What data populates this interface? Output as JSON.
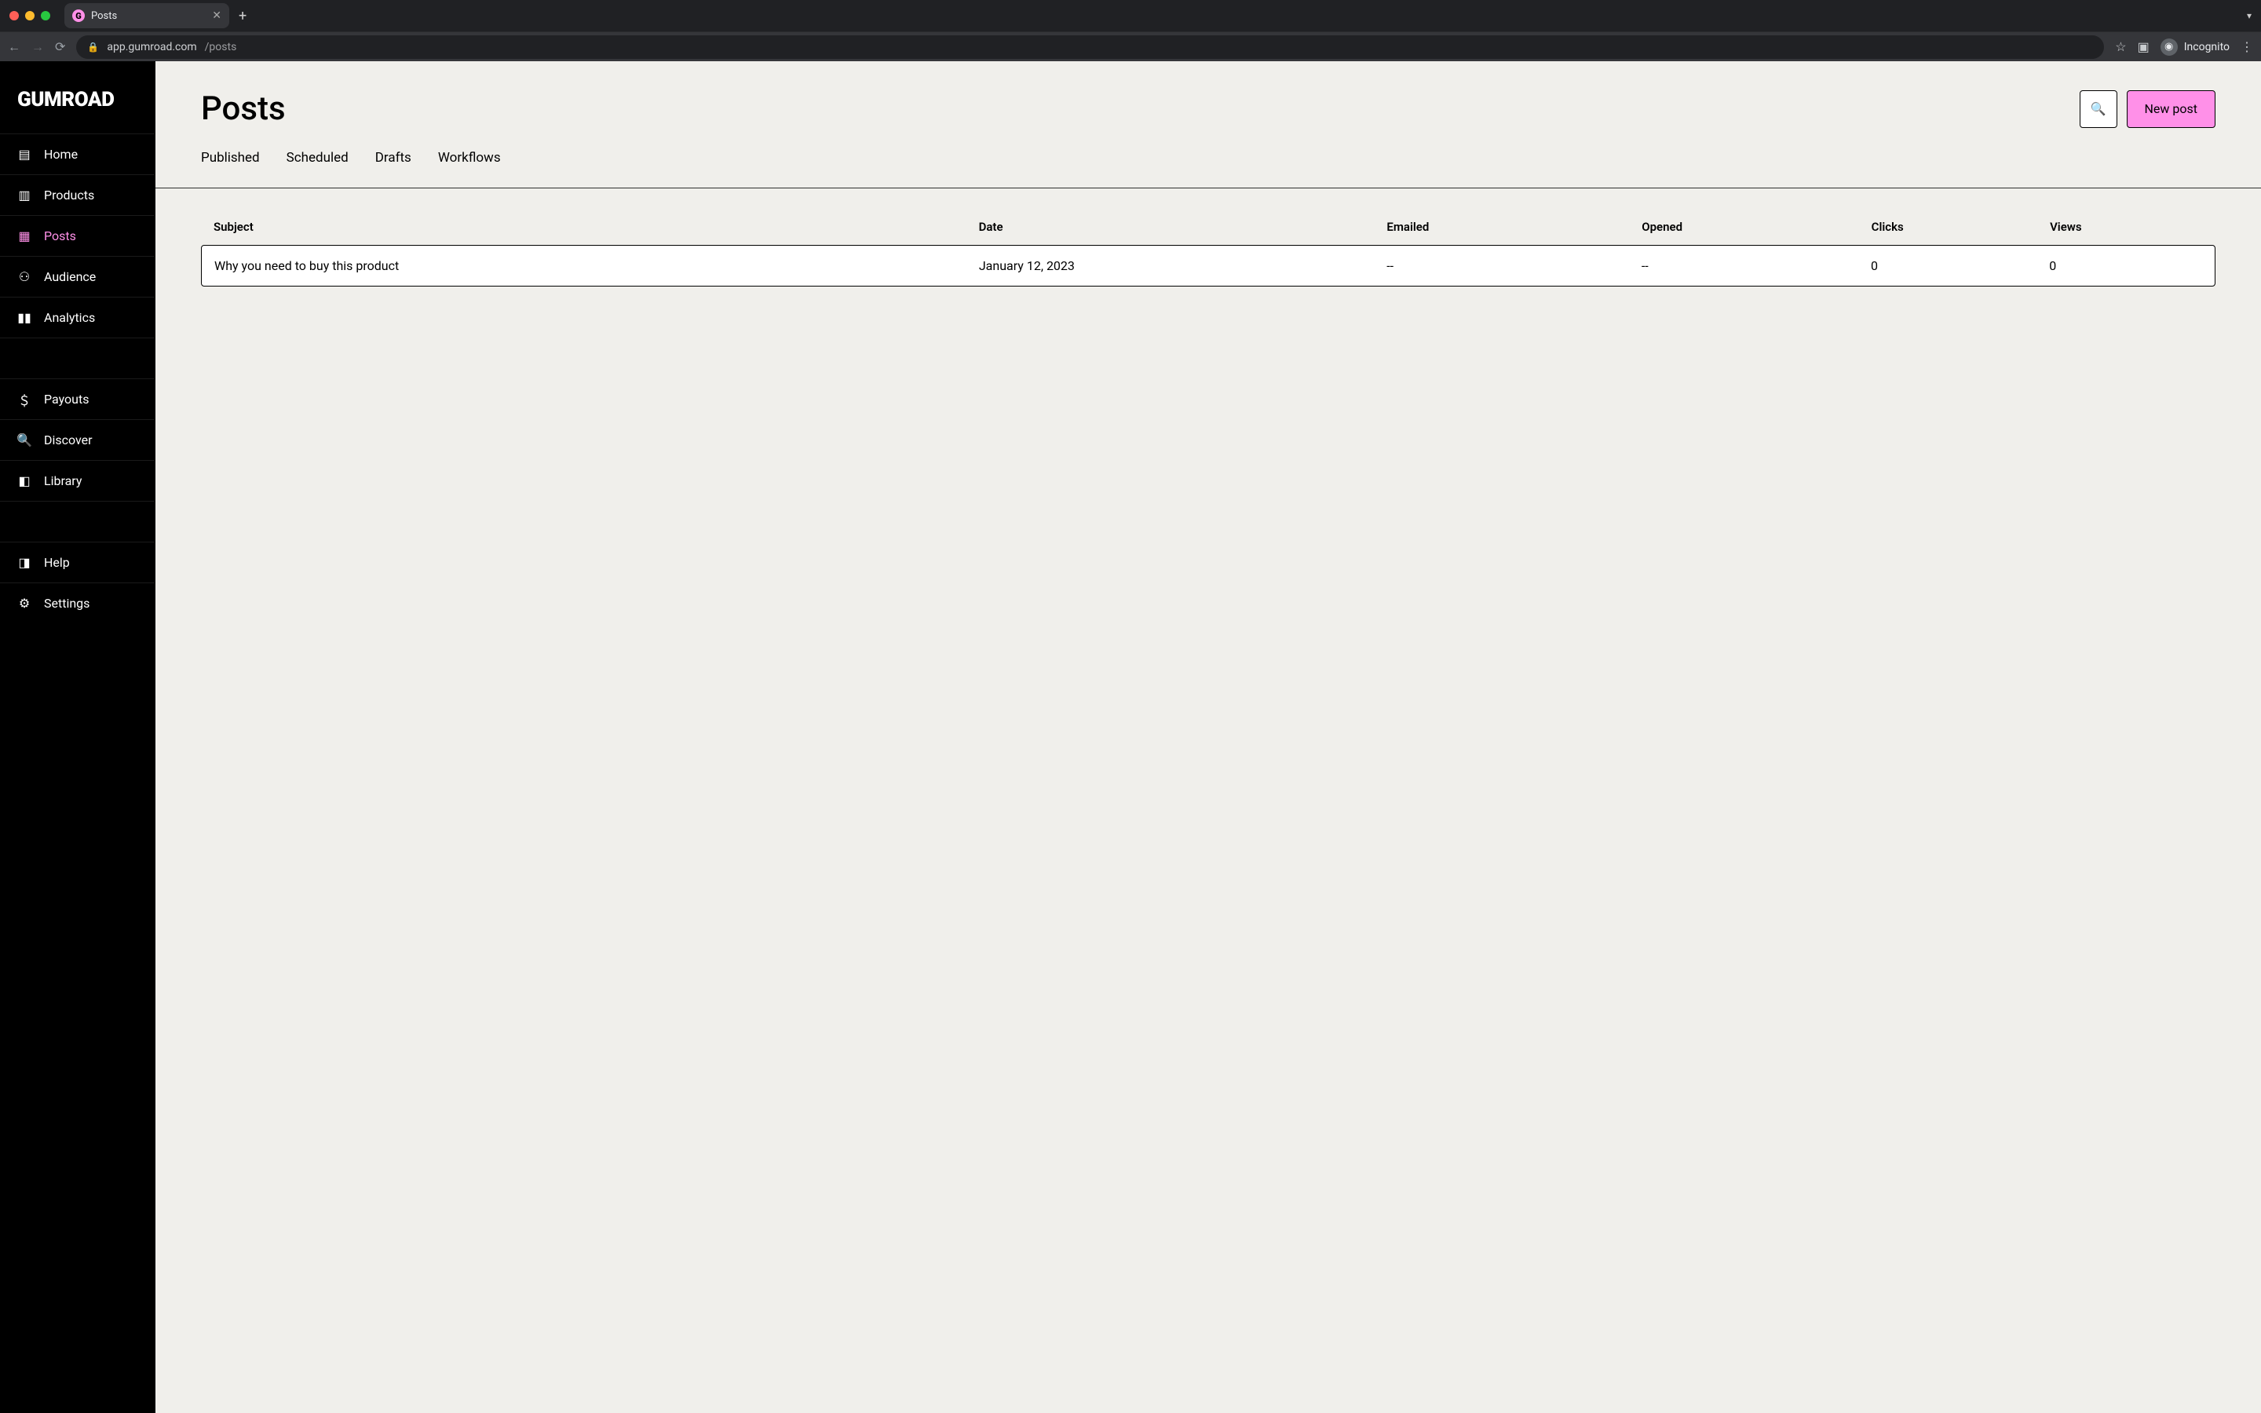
{
  "browser": {
    "tab_title": "Posts",
    "url_host": "app.gumroad.com",
    "url_path": "/posts",
    "incognito_label": "Incognito"
  },
  "brand": "GUMROAD",
  "sidebar": {
    "items": [
      {
        "label": "Home",
        "icon": "home-icon"
      },
      {
        "label": "Products",
        "icon": "archive-icon"
      },
      {
        "label": "Posts",
        "icon": "file-icon",
        "active": true
      },
      {
        "label": "Audience",
        "icon": "users-icon"
      },
      {
        "label": "Analytics",
        "icon": "bar-chart-icon"
      }
    ],
    "items2": [
      {
        "label": "Payouts",
        "icon": "dollar-icon"
      },
      {
        "label": "Discover",
        "icon": "search-icon"
      },
      {
        "label": "Library",
        "icon": "bookmark-icon"
      }
    ],
    "items3": [
      {
        "label": "Help",
        "icon": "book-icon"
      },
      {
        "label": "Settings",
        "icon": "gear-icon"
      }
    ]
  },
  "page": {
    "title": "Posts",
    "new_post_label": "New post",
    "tabs": [
      "Published",
      "Scheduled",
      "Drafts",
      "Workflows"
    ],
    "columns": [
      "Subject",
      "Date",
      "Emailed",
      "Opened",
      "Clicks",
      "Views"
    ],
    "rows": [
      {
        "subject": "Why you need to buy this product",
        "date": "January 12, 2023",
        "emailed": "--",
        "opened": "--",
        "clicks": "0",
        "views": "0"
      }
    ]
  }
}
